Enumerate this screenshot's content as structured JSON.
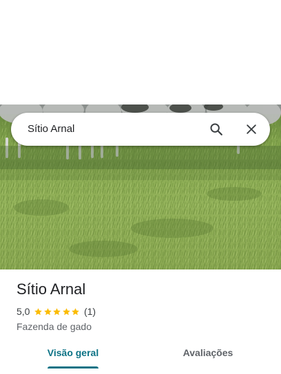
{
  "place": {
    "name": "Sítio Arnal",
    "rating": "5,0",
    "stars": 5,
    "review_count": "(1)",
    "category": "Fazenda de gado"
  },
  "search": {
    "query": "Sítio Arnal",
    "search_icon": "search-icon",
    "close_icon": "close-icon"
  },
  "photo": {
    "subject": "place-photo"
  },
  "tabs": [
    {
      "label": "Visão geral",
      "active": true
    },
    {
      "label": "Avaliações",
      "active": false
    }
  ],
  "colors": {
    "accent": "#0b7285",
    "star": "#fbbc04",
    "text_primary": "#202124",
    "text_secondary": "#5f6368"
  }
}
